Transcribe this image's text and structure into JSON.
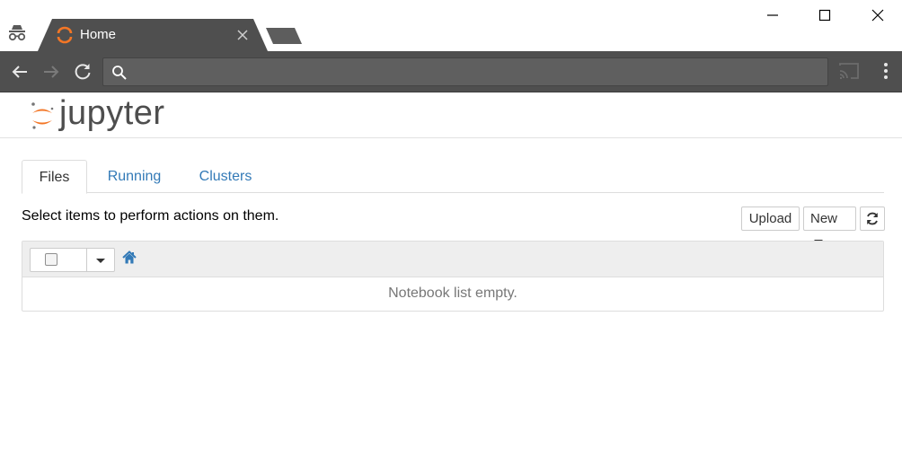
{
  "browser": {
    "tab": {
      "title": "Home"
    },
    "omnibox": {
      "value": "",
      "placeholder": ""
    }
  },
  "jupyter": {
    "logo_text": "jupyter",
    "brand_color": "#f37626",
    "tabs": [
      {
        "label": "Files",
        "active": true
      },
      {
        "label": "Running",
        "active": false
      },
      {
        "label": "Clusters",
        "active": false
      }
    ],
    "hint": "Select items to perform actions on them.",
    "buttons": {
      "upload": "Upload",
      "new": "New"
    },
    "list": {
      "empty_message": "Notebook list empty."
    }
  },
  "icons": {
    "incognito": "incognito-icon",
    "favicon": "jupyter-favicon-icon",
    "close": "close-icon",
    "back": "back-arrow-icon",
    "forward": "forward-arrow-icon",
    "reload": "reload-icon",
    "search": "search-icon",
    "cast": "cast-icon",
    "menu": "kebab-menu-icon",
    "refresh": "refresh-icon",
    "home": "home-icon"
  },
  "colors": {
    "chrome_dark": "#4f4f4f",
    "link_blue": "#337ab7",
    "panel_head": "#eeeeee"
  }
}
